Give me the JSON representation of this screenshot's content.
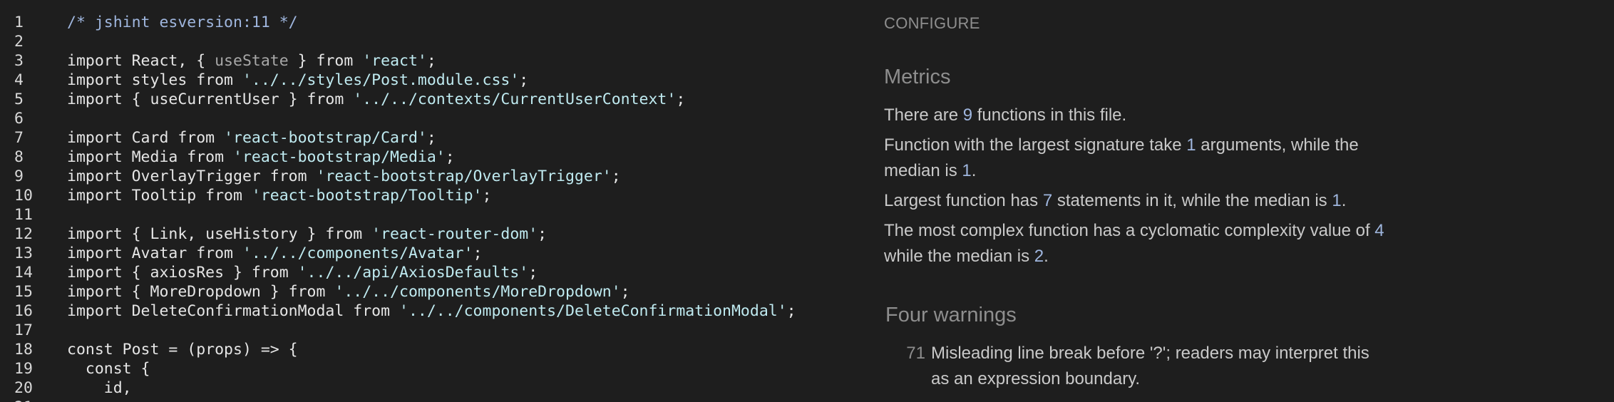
{
  "editor": {
    "lines": [
      {
        "n": "1",
        "tokens": [
          {
            "t": "/* jshint esversion:11 */",
            "c": "cmt"
          }
        ]
      },
      {
        "n": "2",
        "tokens": []
      },
      {
        "n": "3",
        "tokens": [
          {
            "t": "import React, { "
          },
          {
            "t": "useState",
            "c": "dim"
          },
          {
            "t": " } from "
          },
          {
            "t": "'react'",
            "c": "str"
          },
          {
            "t": ";"
          }
        ]
      },
      {
        "n": "4",
        "tokens": [
          {
            "t": "import styles from "
          },
          {
            "t": "'../../styles/Post.module.css'",
            "c": "str"
          },
          {
            "t": ";"
          }
        ]
      },
      {
        "n": "5",
        "tokens": [
          {
            "t": "import { useCurrentUser } from "
          },
          {
            "t": "'../../contexts/CurrentUserContext'",
            "c": "str"
          },
          {
            "t": ";"
          }
        ]
      },
      {
        "n": "6",
        "tokens": []
      },
      {
        "n": "7",
        "tokens": [
          {
            "t": "import Card from "
          },
          {
            "t": "'react-bootstrap/Card'",
            "c": "str"
          },
          {
            "t": ";"
          }
        ]
      },
      {
        "n": "8",
        "tokens": [
          {
            "t": "import Media from "
          },
          {
            "t": "'react-bootstrap/Media'",
            "c": "str"
          },
          {
            "t": ";"
          }
        ]
      },
      {
        "n": "9",
        "tokens": [
          {
            "t": "import OverlayTrigger from "
          },
          {
            "t": "'react-bootstrap/OverlayTrigger'",
            "c": "str"
          },
          {
            "t": ";"
          }
        ]
      },
      {
        "n": "10",
        "tokens": [
          {
            "t": "import Tooltip from "
          },
          {
            "t": "'react-bootstrap/Tooltip'",
            "c": "str"
          },
          {
            "t": ";"
          }
        ]
      },
      {
        "n": "11",
        "tokens": []
      },
      {
        "n": "12",
        "tokens": [
          {
            "t": "import { Link, useHistory } from "
          },
          {
            "t": "'react-router-dom'",
            "c": "str"
          },
          {
            "t": ";"
          }
        ]
      },
      {
        "n": "13",
        "tokens": [
          {
            "t": "import Avatar from "
          },
          {
            "t": "'../../components/Avatar'",
            "c": "str"
          },
          {
            "t": ";"
          }
        ]
      },
      {
        "n": "14",
        "tokens": [
          {
            "t": "import { axiosRes } from "
          },
          {
            "t": "'../../api/AxiosDefaults'",
            "c": "str"
          },
          {
            "t": ";"
          }
        ]
      },
      {
        "n": "15",
        "tokens": [
          {
            "t": "import { MoreDropdown } from "
          },
          {
            "t": "'../../components/MoreDropdown'",
            "c": "str"
          },
          {
            "t": ";"
          }
        ]
      },
      {
        "n": "16",
        "tokens": [
          {
            "t": "import DeleteConfirmationModal from "
          },
          {
            "t": "'../../components/DeleteConfirmationModal'",
            "c": "str"
          },
          {
            "t": ";"
          }
        ]
      },
      {
        "n": "17",
        "tokens": []
      },
      {
        "n": "18",
        "tokens": [
          {
            "t": "const Post = (props) => {"
          }
        ]
      },
      {
        "n": "19",
        "tokens": [
          {
            "t": "  const {"
          }
        ]
      },
      {
        "n": "20",
        "tokens": [
          {
            "t": "    id,"
          }
        ]
      },
      {
        "n": "21",
        "tokens": []
      }
    ]
  },
  "panel": {
    "configure_label": "CONFIGURE",
    "metrics_title": "Metrics",
    "metrics": {
      "m1": {
        "a": "There are ",
        "n1": "9",
        "b": " functions in this file."
      },
      "m2": {
        "a": "Function with the largest signature take ",
        "n1": "1",
        "b": " arguments, while the median is ",
        "n2": "1",
        "c": "."
      },
      "m3": {
        "a": "Largest function has ",
        "n1": "7",
        "b": " statements in it, while the median is ",
        "n2": "1",
        "c": "."
      },
      "m4": {
        "a": "The most complex function has a cyclomatic complexity value of ",
        "n1": "4",
        "b": " while the median is ",
        "n2": "2",
        "c": "."
      }
    },
    "warnings_title": "Four warnings",
    "warning": {
      "line": "71",
      "text": "Misleading line break before '?'; readers may interpret this as an expression boundary."
    }
  },
  "colors": {
    "background": "#1e1e1e",
    "accent_number": "#9fb6de",
    "string": "#bfeaf0",
    "comment": "#9fb6de",
    "muted": "#8e8e8e"
  }
}
